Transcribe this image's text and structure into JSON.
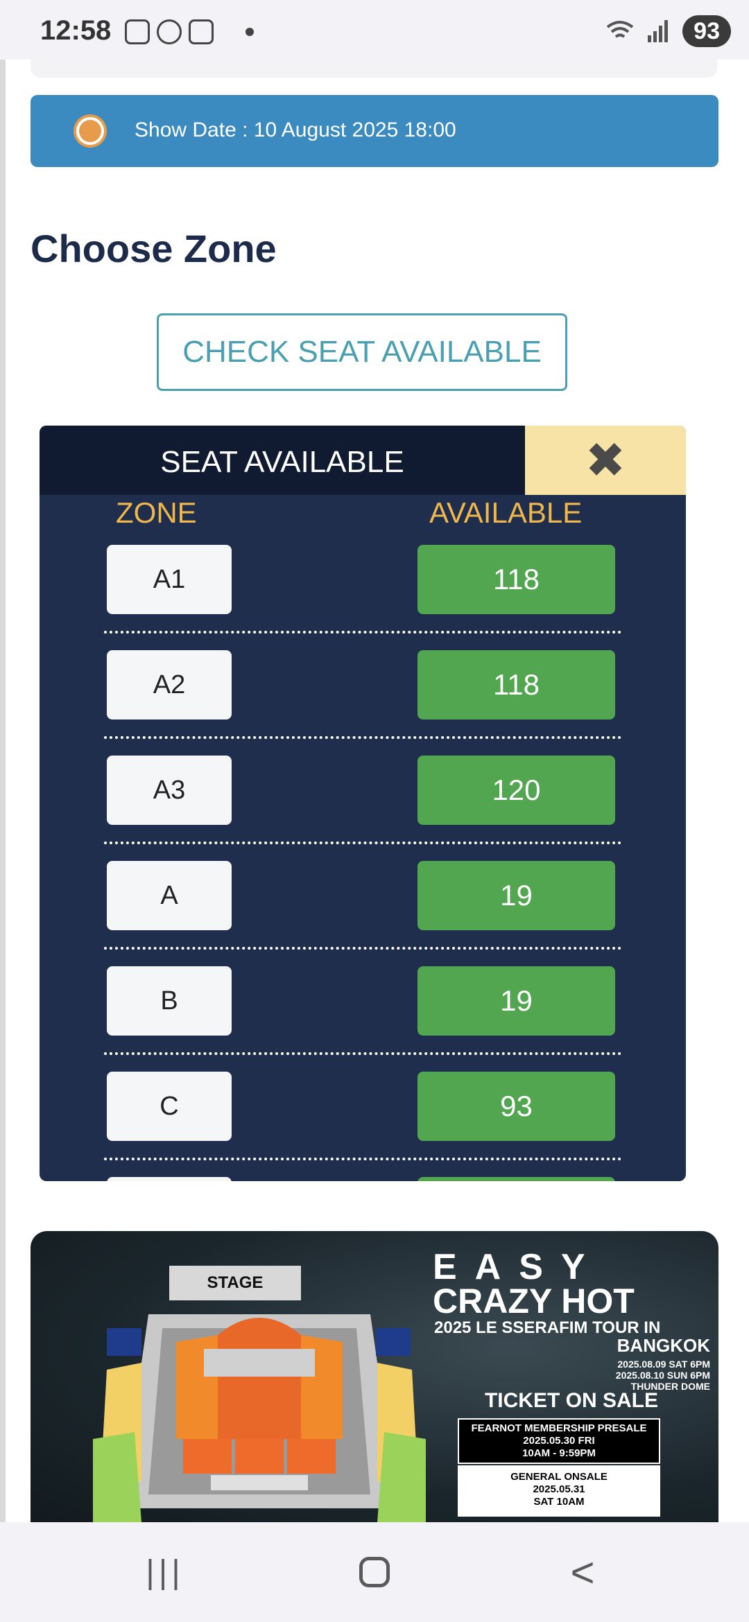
{
  "status_bar": {
    "time": "12:58",
    "battery": "93"
  },
  "show_date": {
    "text": "Show Date : 10 August 2025 18:00"
  },
  "choose_zone": {
    "title": "Choose Zone"
  },
  "check_seat": {
    "label": "CHECK SEAT AVAILABLE"
  },
  "seat_modal": {
    "title": "SEAT AVAILABLE",
    "close_icon": "✖",
    "col_zone": "ZONE",
    "col_available": "AVAILABLE",
    "rows": [
      {
        "zone": "A1",
        "available": "118"
      },
      {
        "zone": "A2",
        "available": "118"
      },
      {
        "zone": "A3",
        "available": "120"
      },
      {
        "zone": "A",
        "available": "19"
      },
      {
        "zone": "B",
        "available": "19"
      },
      {
        "zone": "C",
        "available": "93"
      }
    ]
  },
  "poster": {
    "stage": "STAGE",
    "title_1": "EASY",
    "title_2": "CRAZY HOT",
    "subtitle": "2025 LE SSERAFIM TOUR IN",
    "city": "BANGKOK",
    "date_1": "2025.08.09 SAT 6PM",
    "date_2": "2025.08.10 SUN 6PM",
    "venue": "THUNDER DOME",
    "ticket": "TICKET ON SALE",
    "presale_1": "FEARNOT MEMBERSHIP PRESALE",
    "presale_2": "2025.05.30 FRI",
    "presale_3": "10AM - 9:59PM",
    "onsale_1": "GENERAL ONSALE",
    "onsale_2": "2025.05.31",
    "onsale_3": "SAT 10AM"
  },
  "nav": {
    "recent_icon": "|||",
    "home_icon": "home",
    "back_icon": "<"
  },
  "colors": {
    "accent_blue": "#3b8bc0",
    "modal_bg": "#1f2e4d",
    "available_green": "#52a650",
    "zone_header": "#f0b84c"
  }
}
